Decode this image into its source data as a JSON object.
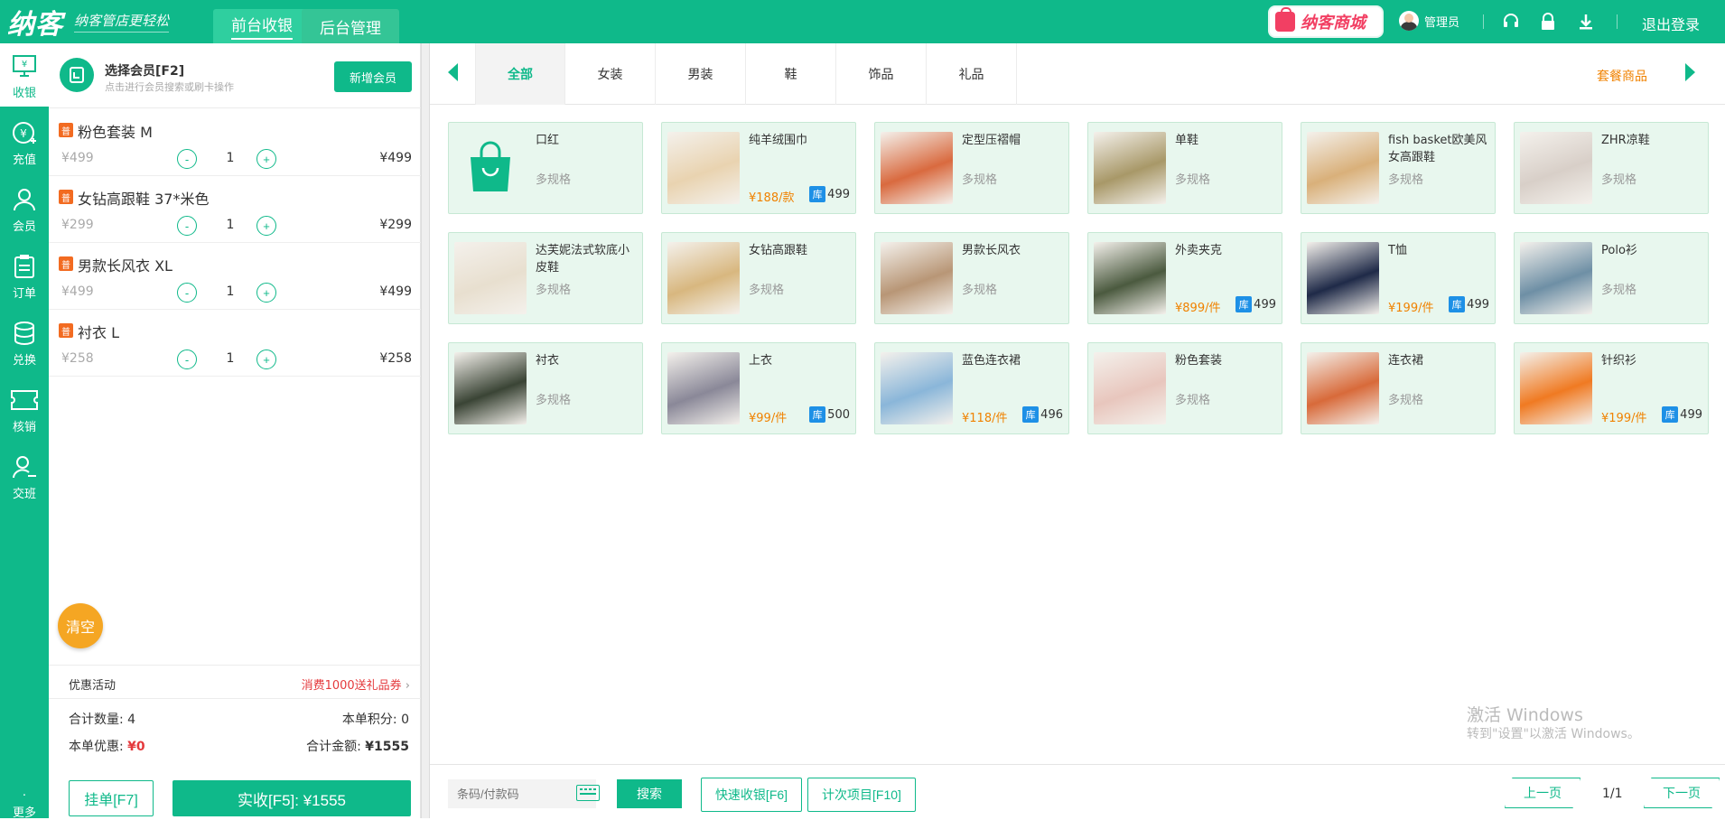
{
  "topbar": {
    "brand": "纳客",
    "slogan": "纳客管店更轻松",
    "tabs": [
      {
        "label": "前台收银"
      },
      {
        "label": "后台管理"
      }
    ],
    "mall": "纳客商城",
    "user": "管理员",
    "logout": "退出登录"
  },
  "sidebar": [
    {
      "label": "收银"
    },
    {
      "label": "充值"
    },
    {
      "label": "会员"
    },
    {
      "label": "订单"
    },
    {
      "label": "兑换"
    },
    {
      "label": "核销"
    },
    {
      "label": "交班"
    },
    {
      "label": "更多"
    }
  ],
  "member": {
    "title": "选择会员[F2]",
    "hint": "点击进行会员搜索或刷卡操作",
    "add": "新增会员"
  },
  "cart": [
    {
      "tag": "普",
      "name": "粉色套装 M",
      "price": "¥499",
      "qty": "1",
      "total": "¥499"
    },
    {
      "tag": "普",
      "name": "女钻高跟鞋 37*米色",
      "price": "¥299",
      "qty": "1",
      "total": "¥299"
    },
    {
      "tag": "普",
      "name": "男款长风衣 XL",
      "price": "¥499",
      "qty": "1",
      "total": "¥499"
    },
    {
      "tag": "普",
      "name": "衬衣 L",
      "price": "¥258",
      "qty": "1",
      "total": "¥258"
    }
  ],
  "controls": {
    "minus": "-",
    "plus": "+"
  },
  "clear": "清空",
  "promo": {
    "label": "优惠活动",
    "value": "消费1000送礼品券"
  },
  "summary": {
    "qty_label": "合计数量:",
    "qty": "4",
    "points_label": "本单积分:",
    "points": "0",
    "discount_label": "本单优惠:",
    "discount": "¥0",
    "amount_label": "合计金额:",
    "amount": "¥1555"
  },
  "actions": {
    "hang": "挂单[F7]",
    "pay": "实收[F5]: ¥1555"
  },
  "categories": [
    {
      "label": "全部"
    },
    {
      "label": "女装"
    },
    {
      "label": "男装"
    },
    {
      "label": "鞋"
    },
    {
      "label": "饰品"
    },
    {
      "label": "礼品"
    }
  ],
  "package": "套餐商品",
  "products": [
    {
      "name": "口红",
      "spec": "多规格",
      "price": "",
      "stock_tag": "",
      "stock": "",
      "img": "bag-icon",
      "color": "#0fb98a"
    },
    {
      "name": "纯羊绒围巾",
      "spec": "",
      "price": "¥188/款",
      "stock_tag": "库",
      "stock": "499",
      "img": "scarf",
      "color": "#e9d3b0"
    },
    {
      "name": "定型压褶帽",
      "spec": "多规格",
      "price": "",
      "stock_tag": "",
      "stock": "",
      "img": "hat",
      "color": "#d96a3f"
    },
    {
      "name": "单鞋",
      "spec": "多规格",
      "price": "",
      "stock_tag": "",
      "stock": "",
      "img": "shoe",
      "color": "#a89868"
    },
    {
      "name": "fish basket欧美风女高跟鞋",
      "spec": "多规格",
      "price": "",
      "stock_tag": "",
      "stock": "",
      "img": "heels",
      "color": "#d9b07a"
    },
    {
      "name": "ZHR凉鞋",
      "spec": "多规格",
      "price": "",
      "stock_tag": "",
      "stock": "",
      "img": "sandal",
      "color": "#d8cfc8"
    },
    {
      "name": "达芙妮法式软底小皮鞋",
      "spec": "多规格",
      "price": "",
      "stock_tag": "",
      "stock": "",
      "img": "loafer",
      "color": "#e8dfcf"
    },
    {
      "name": "女钻高跟鞋",
      "spec": "多规格",
      "price": "",
      "stock_tag": "",
      "stock": "",
      "img": "heels2",
      "color": "#d8b77f"
    },
    {
      "name": "男款长风衣",
      "spec": "多规格",
      "price": "",
      "stock_tag": "",
      "stock": "",
      "img": "coat",
      "color": "#b89676"
    },
    {
      "name": "外卖夹克",
      "spec": "",
      "price": "¥899/件",
      "stock_tag": "库",
      "stock": "499",
      "img": "jacket",
      "color": "#4b5a3f"
    },
    {
      "name": "T恤",
      "spec": "",
      "price": "¥199/件",
      "stock_tag": "库",
      "stock": "499",
      "img": "tshirt",
      "color": "#1f2a48"
    },
    {
      "name": "Polo衫",
      "spec": "多规格",
      "price": "",
      "stock_tag": "",
      "stock": "",
      "img": "polo",
      "color": "#6e8fa5"
    },
    {
      "name": "衬衣",
      "spec": "多规格",
      "price": "",
      "stock_tag": "",
      "stock": "",
      "img": "shirt",
      "color": "#3a4435"
    },
    {
      "name": "上衣",
      "spec": "",
      "price": "¥99/件",
      "stock_tag": "库",
      "stock": "500",
      "img": "top",
      "color": "#8a8898"
    },
    {
      "name": "蓝色连衣裙",
      "spec": "",
      "price": "¥118/件",
      "stock_tag": "库",
      "stock": "496",
      "img": "dress",
      "color": "#8ab6d9"
    },
    {
      "name": "粉色套装",
      "spec": "多规格",
      "price": "",
      "stock_tag": "",
      "stock": "",
      "img": "suit",
      "color": "#e8c6bd"
    },
    {
      "name": "连衣裙",
      "spec": "多规格",
      "price": "",
      "stock_tag": "",
      "stock": "",
      "img": "dress2",
      "color": "#d86a3a"
    },
    {
      "name": "针织衫",
      "spec": "",
      "price": "¥199/件",
      "stock_tag": "库",
      "stock": "499",
      "img": "knit",
      "color": "#f07a22"
    }
  ],
  "bottom": {
    "search_placeholder": "条码/付款码",
    "search": "搜索",
    "quick": "快速收银[F6]",
    "count": "计次项目[F10]",
    "prev": "上一页",
    "page": "1/1",
    "next": "下一页"
  },
  "watermark": {
    "line1": "激活 Windows",
    "line2": "转到\"设置\"以激活 Windows。"
  }
}
